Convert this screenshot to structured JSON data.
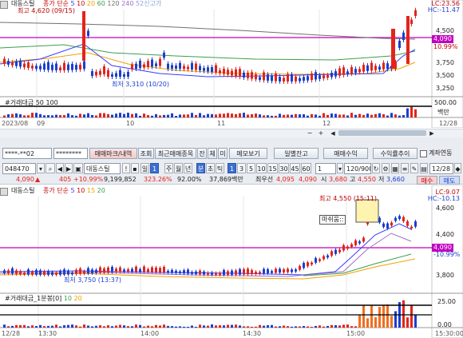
{
  "colors": {
    "up": "#e3241b",
    "down": "#1a3fcf",
    "accent": "#c000c0",
    "ma5": "#3a3aff",
    "ma20": "#f0a000",
    "ma60": "#9a70c8",
    "ma120": "#3aa04a",
    "ma240": "#707070"
  },
  "top_chart": {
    "stock_name": "대동스틸",
    "ma_legend": {
      "label": "종가 단순",
      "periods": [
        "5",
        "10",
        "20",
        "60",
        "120",
        "240"
      ],
      "extra": "52신고가"
    },
    "lc_label": "LC:23.56",
    "hc_label": "HC:-11.47",
    "high_annotation": "최고 4,620 (09/15)",
    "low_annotation": "최저 3,310 (10/20)",
    "y_ticks": [
      "4,500",
      "4,250",
      "4,090",
      "3,750",
      "3,500",
      "3,250"
    ],
    "price_box": "4,090",
    "pct_box": "10.99%",
    "volume_title": "#거래대금",
    "volume_periods": [
      "50",
      "100"
    ],
    "volume_tick": "500.00",
    "volume_unit": "백만",
    "x_labels": [
      "2023/08",
      "09",
      "10",
      "11",
      "12"
    ],
    "x_right_label": "12/28"
  },
  "trade_panel": {
    "account": "****-**02",
    "password": "********",
    "tabs": [
      "매매마크/내역",
      "조회",
      "최근매매종목",
      "잔",
      "체",
      "미",
      "메모보기"
    ],
    "right_tabs": [
      "일별잔고",
      "매매수익",
      "수익률추이"
    ],
    "account_link_label": "계좌연동"
  },
  "toolbar": {
    "code": "048470",
    "search_icon": "search-icon",
    "stock_name": "대동스틸",
    "period_buttons": [
      "일",
      "1",
      "주",
      "월",
      "년",
      "분",
      "초",
      "틱"
    ],
    "interval_buttons": [
      "1",
      "3",
      "5",
      "10",
      "15",
      "30",
      "45",
      "60"
    ],
    "count_value": "1",
    "count_range": "120/900",
    "date_value": "12/28"
  },
  "quote_bar": {
    "price": "4,090",
    "change": "405",
    "pct": "+10.99%",
    "volume": "9,199,852",
    "ratio": "323.26%",
    "strength": "92.00%",
    "amount": "37,869백만",
    "best_ask_label": "최우선",
    "ask": "4,095",
    "bid": "4,090",
    "lo_label": "시",
    "open": "3,680",
    "hi_label": "고",
    "high": "4,550",
    "lo2_label": "저",
    "low": "3,660",
    "buy_label": "매수",
    "sell_label": "매도"
  },
  "bottom_chart": {
    "stock_name": "대동스틸",
    "ma_legend": {
      "label": "종가 단순",
      "periods": [
        "5",
        "10",
        "15",
        "20"
      ]
    },
    "lc_label": "LC:9.07",
    "hc_label": "HC:-10.13",
    "high_annotation": "최고 4,550 (15:11)",
    "low_annotation": "최저 3,750 (13:37)",
    "popup_text": "마쉬움::",
    "y_ticks": [
      "4,600",
      "4,400",
      "4,090",
      "3,800"
    ],
    "price_box": "4,090",
    "pct_box": "-10.99%",
    "volume_title": "#거래대금_1분봉[0]",
    "volume_periods": [
      "10",
      "20"
    ],
    "volume_ticks": [
      "25.00",
      "0.00"
    ],
    "x_labels": [
      "12/28",
      "13:30",
      "14:00",
      "14:30",
      "15:00"
    ],
    "x_right_label": "15:30:00"
  }
}
